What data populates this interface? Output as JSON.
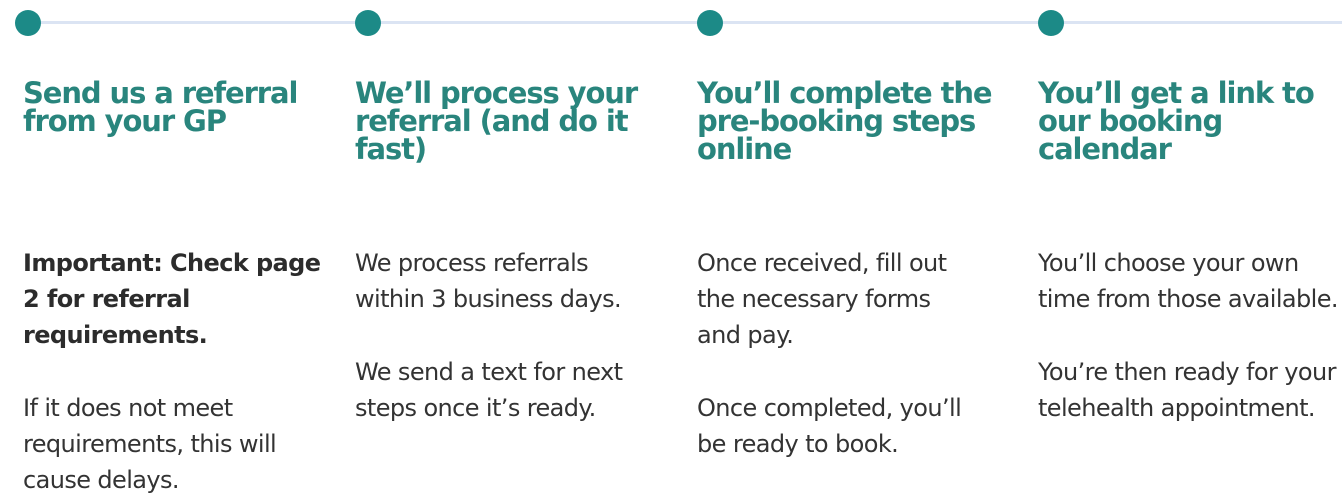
{
  "colors": {
    "accent": "#1c8a87",
    "title": "#29857d",
    "line": "#dbe4f3",
    "text": "#333333"
  },
  "steps": [
    {
      "title": "Send us a referral from your GP",
      "paragraphs": [
        "Important: Check page 2 for referral requirements.",
        "If it does not meet requirements, this will cause delays."
      ]
    },
    {
      "title": "We’ll process your referral (and do it fast)",
      "paragraphs": [
        "We process referrals within 3 business days.",
        "We send a text for next steps once it’s ready."
      ]
    },
    {
      "title": "You’ll complete the pre-booking steps online",
      "paragraphs": [
        "Once received, fill out the necessary forms and pay.",
        "Once completed, you’ll be ready to book."
      ]
    },
    {
      "title": "You’ll get a link to our booking calendar",
      "paragraphs": [
        "You’ll choose your own time from those available.",
        "You’re then ready for your telehealth appointment."
      ]
    }
  ]
}
